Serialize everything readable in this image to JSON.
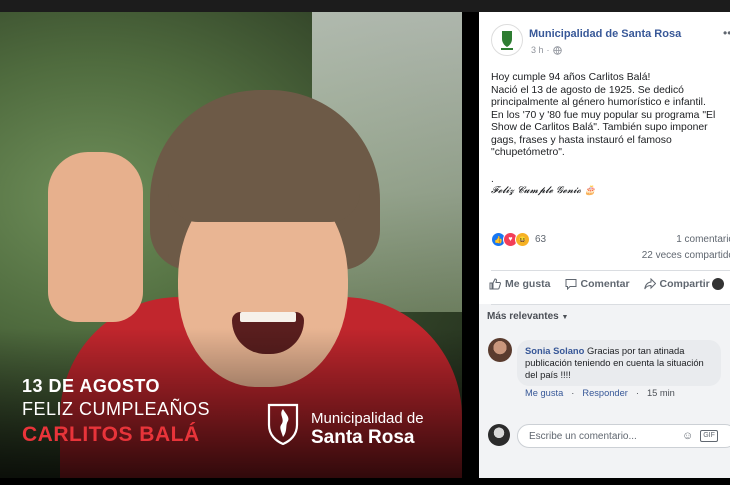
{
  "image_caption": {
    "date": "13 DE AGOSTO",
    "greeting": "FELIZ CUMPLEAÑOS",
    "name": "CARLITOS BALÁ",
    "brand_line1": "Municipalidad de",
    "brand_line2": "Santa Rosa"
  },
  "post": {
    "page_name": "Municipalidad de Santa Rosa",
    "time": "3 h",
    "privacy_icon": "globe-icon",
    "text_lines": [
      "Hoy cumple 94 años Carlitos Balá!",
      "Nació el 13 de agosto de 1925. Se dedicó",
      "principalmente al género humorístico e infantil.",
      "En los '70 y '80 fue muy popular su programa \"El",
      "Show de Carlitos Balá\". También supo imponer",
      "gags, frases y hasta instauró el famoso",
      "\"chupetómetro\"."
    ],
    "dot": ".",
    "script_line": "𝓕𝓮𝓵𝓲𝔃 𝓒𝓾𝓶𝓹𝓵𝓮 𝓖𝓮𝓷𝓲𝓸 🎂",
    "reactions_count": "63",
    "comments_count": "1 comentario",
    "shares_count": "22 veces compartido",
    "actions": {
      "like": "Me gusta",
      "comment": "Comentar",
      "share": "Compartir"
    }
  },
  "comments_section": {
    "sort_label": "Más relevantes",
    "comment": {
      "author": "Sonia Solano",
      "text": "Gracias por tan atinada publicación teniendo en cuenta la situación del país !!!!",
      "like_link": "Me gusta",
      "reply_link": "Responder",
      "time": "15 min"
    },
    "input_placeholder": "Escribe un comentario..."
  },
  "colors": {
    "fb_blue": "#385898",
    "brand_red": "#e8343a",
    "like_blue": "#1877f2"
  }
}
